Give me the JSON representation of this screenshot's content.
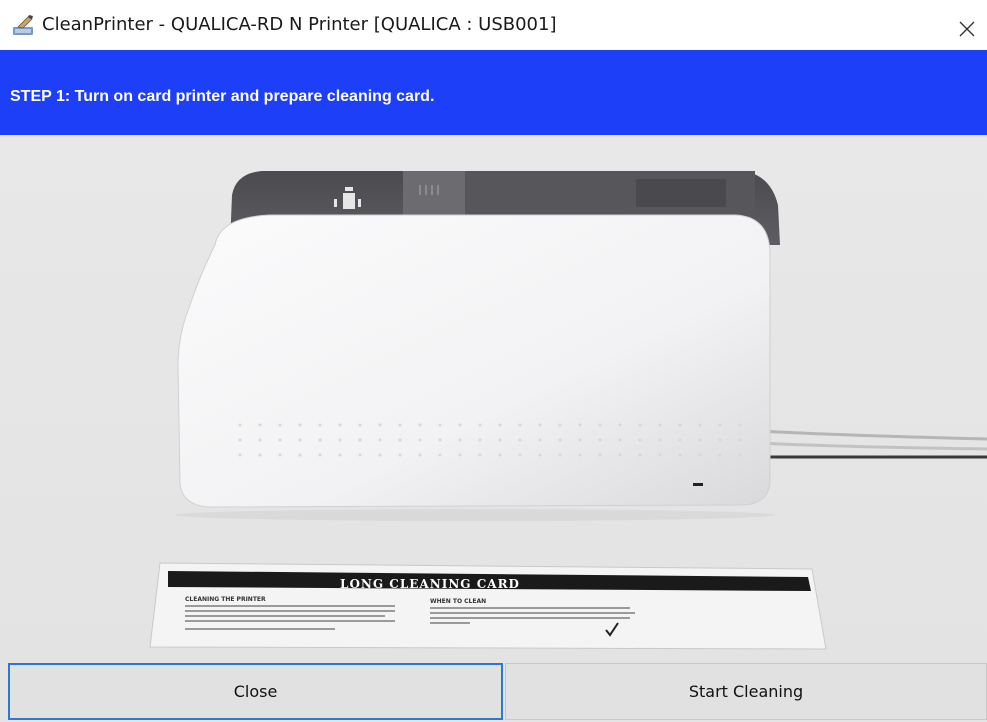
{
  "window": {
    "title": "CleanPrinter - QUALICA-RD N Printer [QUALICA : USB001]",
    "close_icon": "close-icon",
    "app_icon": "printer-cleaning-icon"
  },
  "banner": {
    "step_text": "STEP 1:  Turn on card printer and prepare cleaning card.",
    "color": "#1d3ff8"
  },
  "image": {
    "description_icon": "card-printer-photo",
    "card": {
      "title": "LONG CLEANING CARD",
      "section1": "CLEANING THE PRINTER",
      "section2": "WHEN TO CLEAN"
    }
  },
  "buttons": {
    "close_label": "Close",
    "start_label": "Start Cleaning"
  }
}
